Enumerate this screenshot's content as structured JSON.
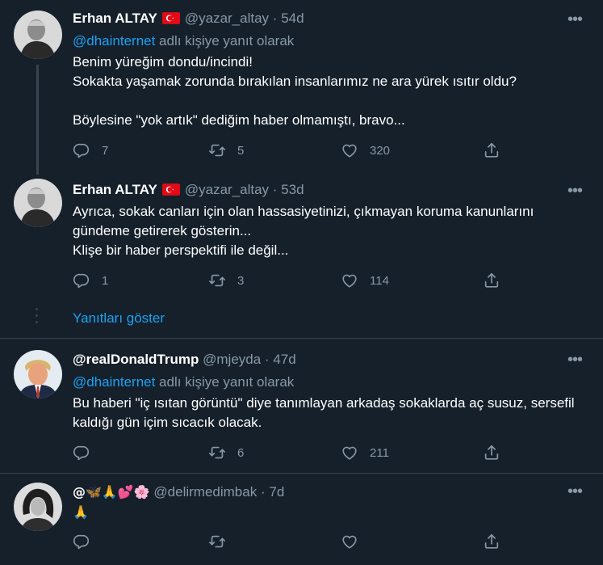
{
  "tweets": [
    {
      "name": "Erhan ALTAY",
      "flag": "turkey-flag",
      "handle": "@yazar_altay",
      "dot": "·",
      "time": "54d",
      "reply_mention": "@dhainternet",
      "reply_suffix": " adlı kişiye yanıt olarak",
      "text": "Benim yüreğim dondu/incindi!\nSokakta yaşamak zorunda bırakılan insanlarımız ne ara yürek ısıtır oldu?\n\nBöylesine \"yok artık\" dediğim haber olmamıştı, bravo...",
      "replies": "7",
      "retweets": "5",
      "likes": "320"
    },
    {
      "name": "Erhan ALTAY",
      "flag": "turkey-flag",
      "handle": "@yazar_altay",
      "dot": "·",
      "time": "53d",
      "text": "Ayrıca, sokak canları için olan hassasiyetinizi, çıkmayan koruma kanunlarını gündeme getirerek gösterin...\nKlişe bir haber perspektifi ile değil...",
      "replies": "1",
      "retweets": "3",
      "likes": "114"
    },
    {
      "name": "@realDonaldTrump",
      "handle": "@mjeyda",
      "dot": "·",
      "time": "47d",
      "reply_mention": "@dhainternet",
      "reply_suffix": " adlı kişiye yanıt olarak",
      "text": "Bu haberi \"iç ısıtan görüntü\" diye tanımlayan arkadaş sokaklarda aç susuz, sersefil kaldığı gün içim sıcacık olacak.",
      "replies": "",
      "retweets": "6",
      "likes": "211"
    },
    {
      "name": "@🦋🙏💕🌸",
      "handle": "@delirmedimbak",
      "dot": "·",
      "time": "7d",
      "text": "🙏",
      "replies": "",
      "retweets": "",
      "likes": ""
    }
  ],
  "show_replies": "Yanıtları göster",
  "more_glyph": "•••",
  "colors": {
    "background": "#15202b",
    "secondary_text": "#8899a6",
    "link": "#1da1f2",
    "divider": "#38444d"
  }
}
